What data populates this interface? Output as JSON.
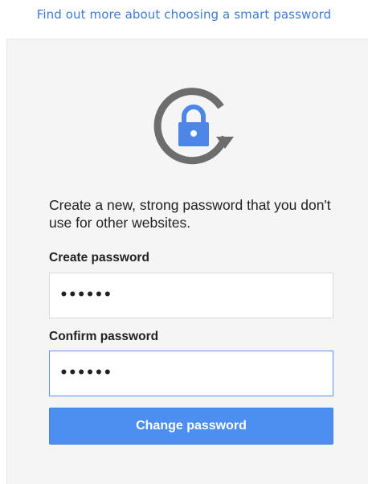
{
  "header": {
    "help_link": "Find out more about choosing a smart password"
  },
  "card": {
    "icon": "lock-refresh-icon",
    "intro_text": "Create a new, strong password that you don't use for other websites.",
    "create_label": "Create password",
    "create_value": "••••••",
    "confirm_label": "Confirm password",
    "confirm_value": "••••••",
    "submit_label": "Change password"
  },
  "colors": {
    "link": "#3e7bd9",
    "button": "#4d8ff0",
    "lock": "#4d86e6",
    "arrow": "#6d6d6d",
    "focus_border": "#5f92e6"
  }
}
